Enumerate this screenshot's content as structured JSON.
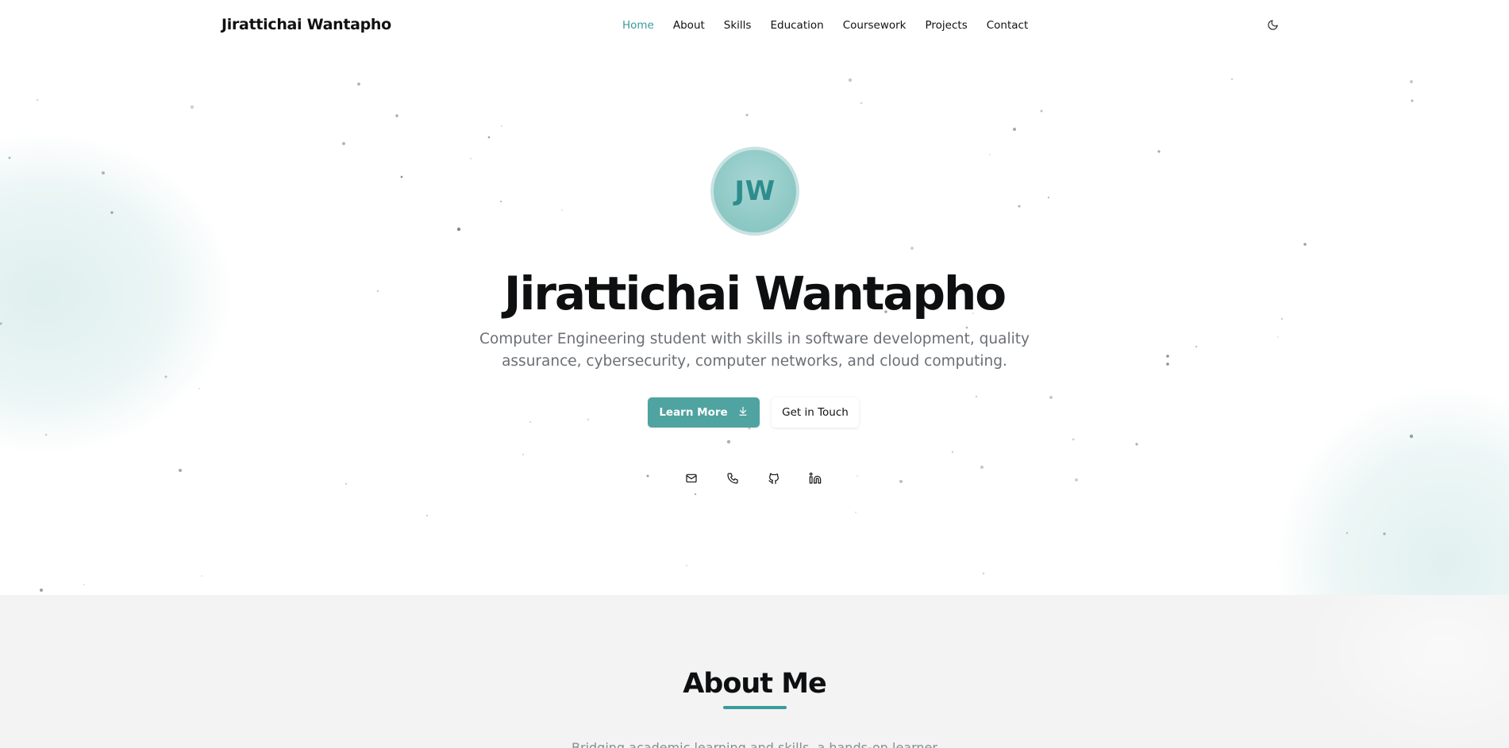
{
  "header": {
    "brand": "Jirattichai Wantapho",
    "nav": [
      "Home",
      "About",
      "Skills",
      "Education",
      "Coursework",
      "Projects",
      "Contact"
    ],
    "active_nav": "Home",
    "theme_toggle_icon": "moon-icon"
  },
  "hero": {
    "avatar_initials": "JW",
    "title": "Jirattichai Wantapho",
    "subtitle": "Computer Engineering student with skills in software development, quality assurance, cybersecurity, computer networks, and cloud computing.",
    "primary_button": "Learn More",
    "primary_button_icon": "arrow-down-icon",
    "secondary_button": "Get in Touch",
    "social_icons": [
      "mail-icon",
      "phone-icon",
      "github-icon",
      "linkedin-icon"
    ]
  },
  "about": {
    "title": "About Me",
    "intro_partial": "Bridging academic learning and skills, a hands-on learner"
  },
  "colors": {
    "accent": "#3a9b9b",
    "button": "#4fa3a0",
    "avatar": "#8fc9c6",
    "text_muted": "#6b6f75",
    "section_bg": "#f3f3f3"
  }
}
